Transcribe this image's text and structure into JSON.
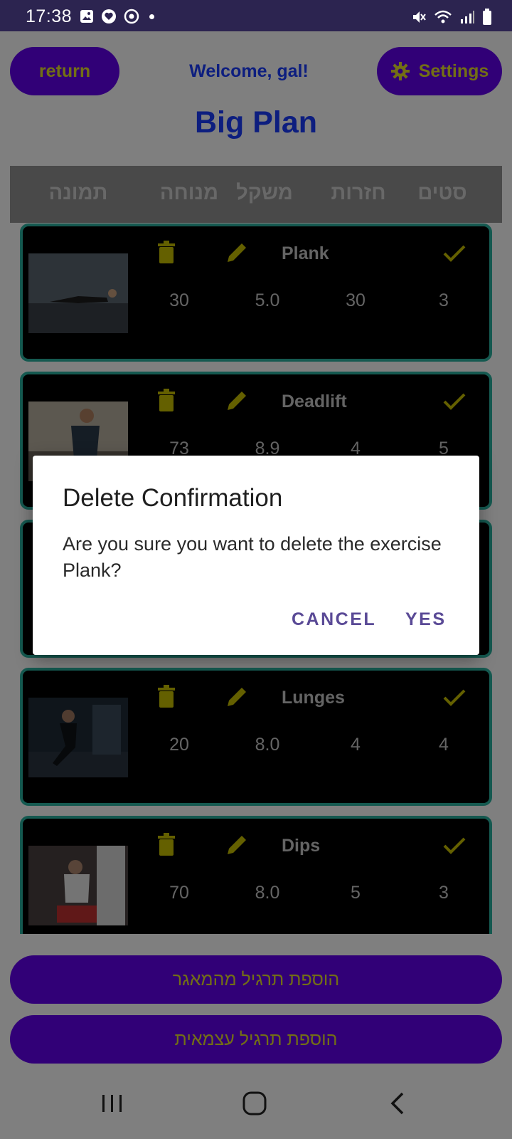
{
  "status_bar": {
    "time": "17:38",
    "left_icons": [
      "gallery-icon",
      "health-icon",
      "sync-icon"
    ],
    "right_icons": [
      "mute-icon",
      "wifi-icon",
      "signal-icon",
      "battery-icon"
    ]
  },
  "header": {
    "return_label": "return",
    "welcome": "Welcome, gal!",
    "settings_label": "Settings",
    "plan_title": "Big Plan"
  },
  "table_header": {
    "sets": "סטים",
    "reps": "חזרות",
    "weight": "משקל",
    "rest": "מנוחה",
    "image": "תמונה"
  },
  "exercises": [
    {
      "name": "Plank",
      "rest": "30",
      "weight": "5.0",
      "reps": "30",
      "sets": "3"
    },
    {
      "name": "Deadlift",
      "rest": "73",
      "weight": "8.9",
      "reps": "4",
      "sets": "5"
    },
    {
      "name": "",
      "rest": "",
      "weight": "",
      "reps": "",
      "sets": ""
    },
    {
      "name": "Lunges",
      "rest": "20",
      "weight": "8.0",
      "reps": "4",
      "sets": "4"
    },
    {
      "name": "Dips",
      "rest": "70",
      "weight": "8.0",
      "reps": "5",
      "sets": "3"
    }
  ],
  "bottom": {
    "add_from_repo": "הוספת תרגיל מהמאגר",
    "add_custom": "הוספת תרגיל עצמאית"
  },
  "dialog": {
    "title": "Delete Confirmation",
    "message": "Are you sure you want to delete the exercise Plank?",
    "cancel": "CANCEL",
    "yes": "YES"
  },
  "colors": {
    "primary": "#6200ee",
    "accent_text": "#e6de2a",
    "title_blue": "#1a3cff",
    "card_border": "#2ab3a0",
    "dialog_button": "#5a4a96"
  }
}
